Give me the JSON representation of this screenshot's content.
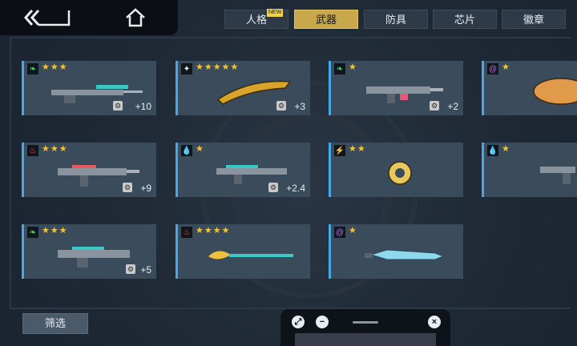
{
  "tabs": [
    {
      "label": "人格",
      "badge": "NEW"
    },
    {
      "label": "武器",
      "active": true
    },
    {
      "label": "防具"
    },
    {
      "label": "芯片"
    },
    {
      "label": "徽章"
    }
  ],
  "colors": {
    "accent": "#c8a84a",
    "star": "#f3c43a",
    "card_border": "#4aa7e6"
  },
  "weapons": [
    {
      "element": "leaf-icon",
      "stars": "★★★",
      "plus": "+10",
      "kind": "sniper-rifle"
    },
    {
      "element": "sparkle-icon",
      "stars": "★★★★★",
      "plus": "+3",
      "kind": "golden-blade"
    },
    {
      "element": "leaf-icon",
      "stars": "★",
      "plus": "+2",
      "kind": "assault-rifle"
    },
    {
      "element": "spiral-icon",
      "stars": "★",
      "plus": "",
      "kind": "fist-glove"
    },
    {
      "element": "fire-icon",
      "stars": "★★★",
      "plus": "+9",
      "kind": "assault-rifle"
    },
    {
      "element": "water-icon",
      "stars": "★",
      "plus": "+2.4",
      "kind": "shotgun"
    },
    {
      "element": "lightning-icon",
      "stars": "★★",
      "plus": "",
      "kind": "drum-launcher"
    },
    {
      "element": "water-icon",
      "stars": "★",
      "plus": "",
      "kind": "pistol"
    },
    {
      "element": "leaf-icon",
      "stars": "★★★",
      "plus": "+5",
      "kind": "heavy-rifle"
    },
    {
      "element": "fire-icon",
      "stars": "★★★★",
      "plus": "",
      "kind": "spear-brush"
    },
    {
      "element": "spiral-icon",
      "stars": "★",
      "plus": "",
      "kind": "sword"
    }
  ],
  "filter_label": "筛选"
}
